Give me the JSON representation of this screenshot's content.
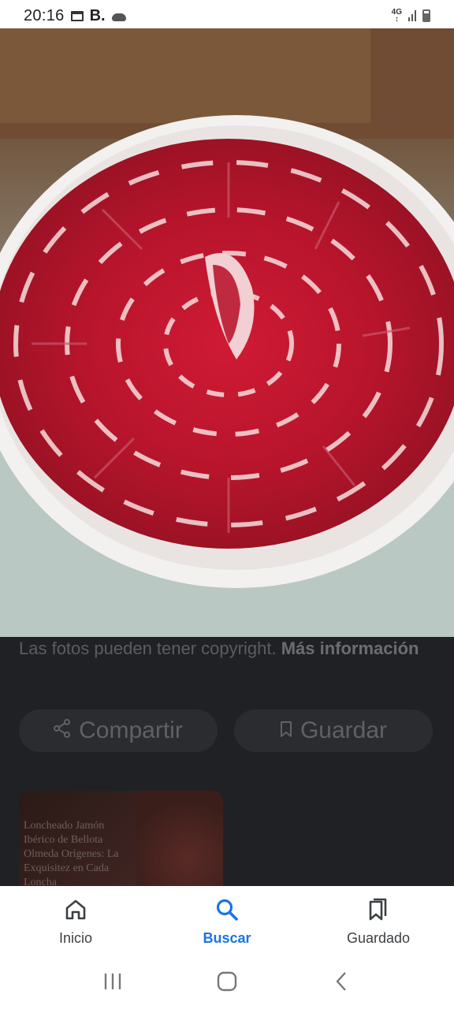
{
  "status_bar": {
    "time": "20:16",
    "app_letter": "B.",
    "network": "4G",
    "icons": [
      "calendar-icon",
      "cloud-icon",
      "network-4g-icon",
      "signal-icon",
      "battery-icon"
    ]
  },
  "photo": {
    "subject": "plate-of-sliced-iberian-ham"
  },
  "info": {
    "copyright_text": "Las fotos pueden tener copyright.",
    "more_info_label": "Más información"
  },
  "actions": {
    "share_label": "Compartir",
    "save_label": "Guardar"
  },
  "related": {
    "title": "Loncheado Jamón Ibérico de Bellota Olmeda Orígenes: La Exquisitez en Cada Loncha"
  },
  "bottom_nav": {
    "items": [
      {
        "label": "Inicio",
        "icon": "home-icon",
        "active": false
      },
      {
        "label": "Buscar",
        "icon": "search-icon",
        "active": true
      },
      {
        "label": "Guardado",
        "icon": "bookmarks-icon",
        "active": false
      }
    ]
  },
  "colors": {
    "accent": "#1a73e8",
    "scrim": "#202124",
    "ham": "#b3172b"
  }
}
